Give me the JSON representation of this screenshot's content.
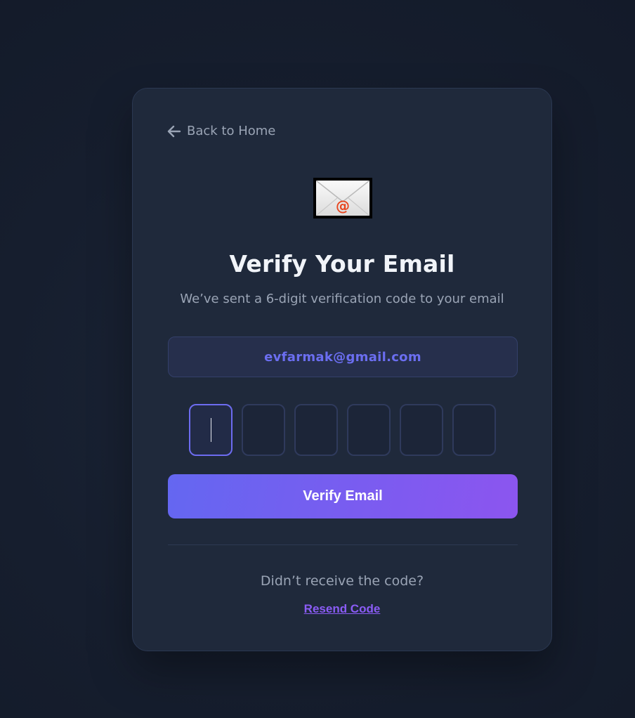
{
  "nav": {
    "back_label": "Back to Home",
    "back_icon": "arrow-left-icon"
  },
  "icon": {
    "envelope": "envelope-at-icon",
    "at_symbol": "@"
  },
  "header": {
    "title": "Verify Your Email",
    "subtitle": "We’ve sent a 6-digit verification code to your email"
  },
  "email": {
    "value": "evfarmak@gmail.com"
  },
  "code": {
    "digits": [
      "",
      "",
      "",
      "",
      "",
      ""
    ],
    "length": 6
  },
  "actions": {
    "verify_label": "Verify Email",
    "resend_prompt": "Didn’t receive the code?",
    "resend_label": "Resend Code"
  },
  "colors": {
    "background": "#161e2e",
    "card": "#1f293b",
    "accent": "#6467f1",
    "accent_end": "#8c55ef",
    "link": "#8b5cf6",
    "email_text": "#6b6ef0"
  }
}
